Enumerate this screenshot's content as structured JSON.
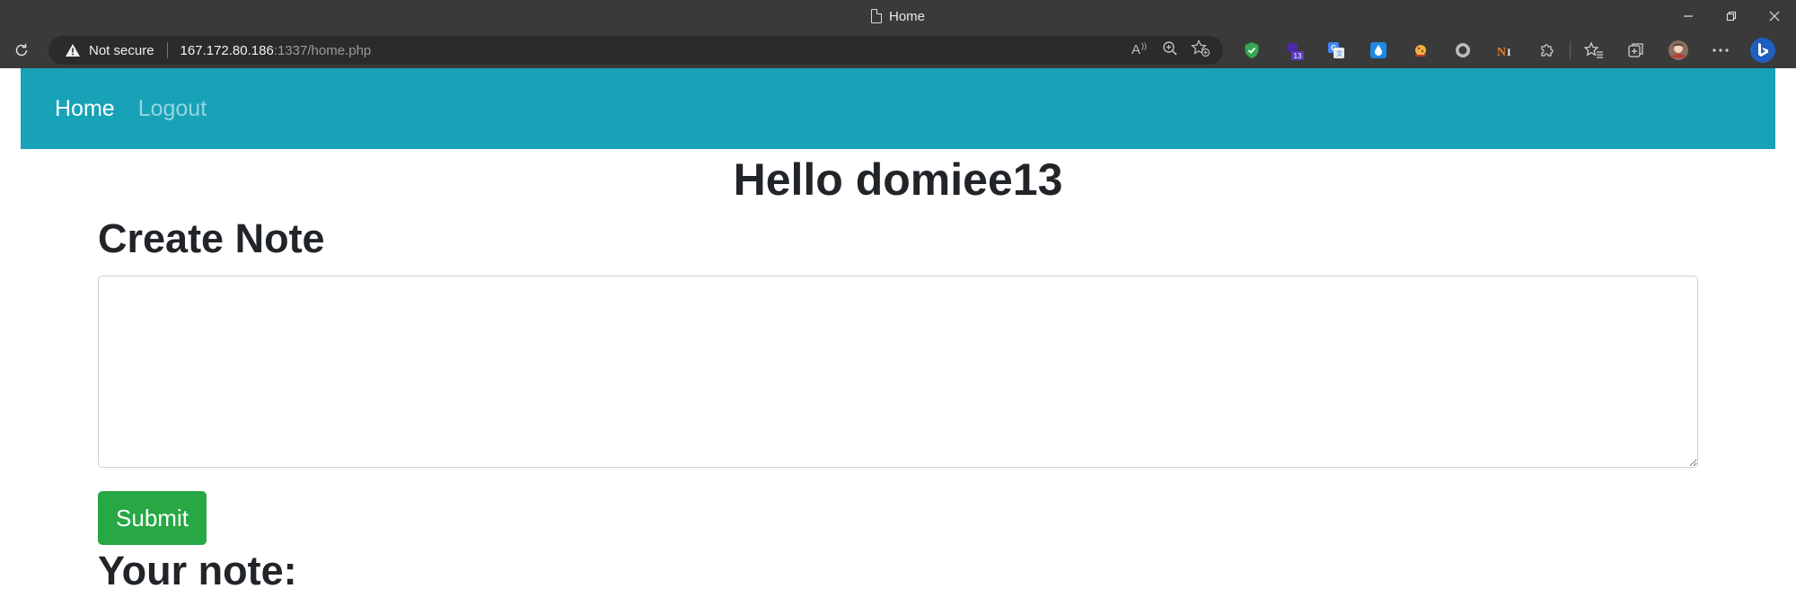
{
  "browser": {
    "tab_title": "Home",
    "security_label": "Not secure",
    "url_host": "167.172.80.186",
    "url_rest": ":1337/home.php",
    "extension_badge": "13",
    "window_controls": {
      "minimize": "—",
      "restore": "❐",
      "close": "✕"
    },
    "icons": [
      "reload-icon",
      "warning-icon",
      "read-aloud-icon",
      "zoom-icon",
      "favorite-icon",
      "favorites-icon",
      "collections-icon",
      "profile-icon",
      "more-icon",
      "bing-icon"
    ]
  },
  "navbar": {
    "home_label": "Home",
    "logout_label": "Logout",
    "bg_color": "#17a2b8"
  },
  "main": {
    "greeting": "Hello domiee13",
    "create_heading": "Create Note",
    "note_value": "",
    "submit_label": "Submit",
    "your_note_heading": "Your note:"
  },
  "colors": {
    "submit": "#28a745",
    "text": "#212529"
  }
}
